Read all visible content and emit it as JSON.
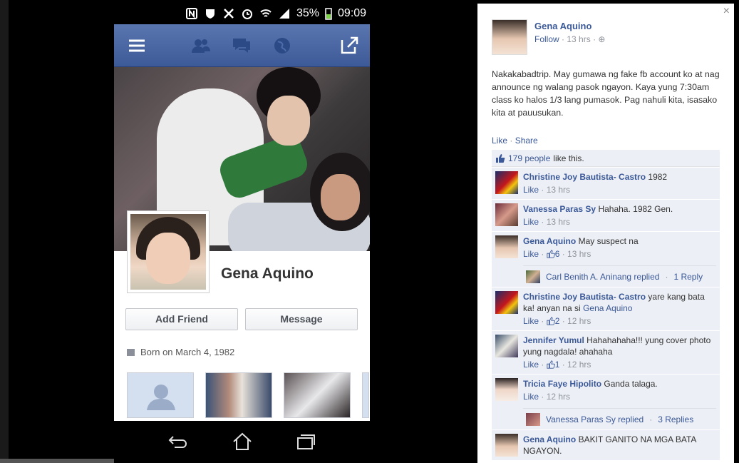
{
  "status_bar": {
    "battery": "35%",
    "time": "09:09"
  },
  "profile": {
    "name": "Gena Aquino",
    "add_friend": "Add Friend",
    "message": "Message",
    "born": "Born on March 4, 1982"
  },
  "post": {
    "author": "Gena Aquino",
    "follow": "Follow",
    "time": "13 hrs",
    "text": "Nakakabadtrip. May gumawa ng fake fb account ko at nag announce ng walang pasok ngayon. Kaya yung 7:30am class ko halos 1/3 lang pumasok. Pag nahuli kita, isasako kita at pauusukan.",
    "like": "Like",
    "share": "Share",
    "likes_count": "179 people",
    "likes_suffix": "like this."
  },
  "comments": [
    {
      "author": "Christine Joy Bautista- Castro",
      "text": "1982",
      "like": "Like",
      "likes": "",
      "time": "13 hrs"
    },
    {
      "author": "Vanessa Paras Sy",
      "text": "Hahaha. 1982 Gen.",
      "like": "Like",
      "likes": "",
      "time": "13 hrs"
    },
    {
      "author": "Gena Aquino",
      "text": "May suspect na",
      "like": "Like",
      "likes": "6",
      "time": "13 hrs",
      "reply_author": "Carl Benith A. Aninang replied",
      "reply_count": "1 Reply"
    },
    {
      "author": "Christine Joy Bautista- Castro",
      "text": "yare kang bata ka! anyan na si",
      "mention": "Gena Aquino",
      "like": "Like",
      "likes": "2",
      "time": "12 hrs"
    },
    {
      "author": "Jennifer Yumul",
      "text": "Hahahahaha!!! yung cover photo yung nagdala! ahahaha",
      "like": "Like",
      "likes": "1",
      "time": "12 hrs"
    },
    {
      "author": "Tricia Faye Hipolito",
      "text": "Ganda talaga.",
      "like": "Like",
      "likes": "",
      "time": "12 hrs",
      "reply_author": "Vanessa Paras Sy replied",
      "reply_count": "3 Replies"
    },
    {
      "author": "Gena Aquino",
      "text": "BAKIT GANITO NA MGA BATA NGAYON.",
      "like": "",
      "likes": "",
      "time": ""
    }
  ],
  "close": "×"
}
